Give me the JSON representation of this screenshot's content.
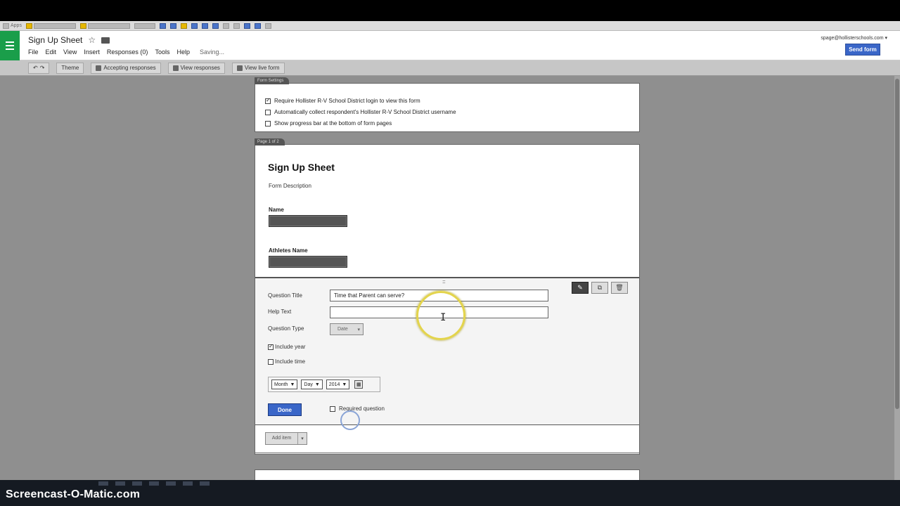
{
  "bookmarks": [
    "Apps"
  ],
  "header": {
    "title": "Sign Up Sheet",
    "menu": [
      "File",
      "Edit",
      "View",
      "Insert",
      "Responses (0)",
      "Tools",
      "Help"
    ],
    "saving": "Saving...",
    "account": "spage@hollisterschools.com ▾",
    "send_form": "Send form"
  },
  "toolbar": {
    "theme": "Theme",
    "accepting": "Accepting responses",
    "view_responses": "View responses",
    "view_live": "View live form"
  },
  "settings": {
    "tab": "Form Settings",
    "items": [
      {
        "label": "Require Hollister R-V School District login to view this form",
        "checked": true
      },
      {
        "label": "Automatically collect respondent's Hollister R-V School District username",
        "checked": false
      },
      {
        "label": "Show progress bar at the bottom of form pages",
        "checked": false
      }
    ]
  },
  "form": {
    "tab": "Page 1 of 2",
    "title": "Sign Up Sheet",
    "description": "Form Description",
    "questions": [
      {
        "label": "Name"
      },
      {
        "label": "Athletes Name"
      }
    ]
  },
  "editor": {
    "question_title_label": "Question Title",
    "question_title_value": "Time that Parent can serve?",
    "help_text_label": "Help Text",
    "help_text_value": "",
    "question_type_label": "Question Type",
    "question_type_value": "Date",
    "include_year": "Include year",
    "include_year_checked": true,
    "include_time": "Include time",
    "include_time_checked": false,
    "month": "Month",
    "day": "Day",
    "year": "2014",
    "done": "Done",
    "required": "Required question",
    "required_checked": false
  },
  "add_item": "Add item",
  "watermark": "Screencast-O-Matic.com"
}
